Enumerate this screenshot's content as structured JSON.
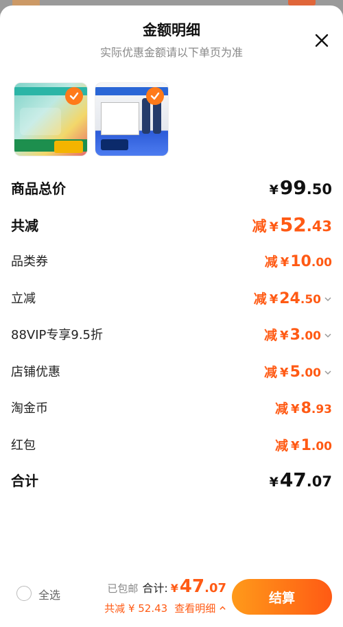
{
  "sheet": {
    "title": "金额明细",
    "subtitle": "实际优惠金额请以下单页为准"
  },
  "summary": {
    "goods_total": {
      "label": "商品总价",
      "yen": "¥",
      "int": "99",
      "dec": ".50"
    },
    "total_reduction": {
      "label": "共减",
      "prefix": "减",
      "yen": "¥",
      "int": "52",
      "dec": ".43"
    },
    "discounts": [
      {
        "label": "品类券",
        "prefix": "减",
        "yen": "¥",
        "int": "10",
        "dec": ".00",
        "expandable": false
      },
      {
        "label": "立减",
        "prefix": "减",
        "yen": "¥",
        "int": "24",
        "dec": ".50",
        "expandable": true
      },
      {
        "label": "88VIP专享9.5折",
        "prefix": "减",
        "yen": "¥",
        "int": "3",
        "dec": ".00",
        "expandable": true
      },
      {
        "label": "店铺优惠",
        "prefix": "减",
        "yen": "¥",
        "int": "5",
        "dec": ".00",
        "expandable": true
      },
      {
        "label": "淘金币",
        "prefix": "减",
        "yen": "¥",
        "int": "8",
        "dec": ".93",
        "expandable": false
      },
      {
        "label": "红包",
        "prefix": "减",
        "yen": "¥",
        "int": "1",
        "dec": ".00",
        "expandable": false
      }
    ],
    "grand_total": {
      "label": "合计",
      "yen": "¥",
      "int": "47",
      "dec": ".07"
    }
  },
  "footer": {
    "select_all": "全选",
    "free_shipping": "已包邮",
    "total_label": "合计:",
    "total_yen": "¥",
    "total_int": "47",
    "total_dec": ".07",
    "reduction_text": "共减 ¥ 52.43",
    "view_detail": "查看明细",
    "checkout": "结算"
  },
  "colors": {
    "accent": "#ff5a14",
    "accent_light": "#ff9a1a"
  }
}
